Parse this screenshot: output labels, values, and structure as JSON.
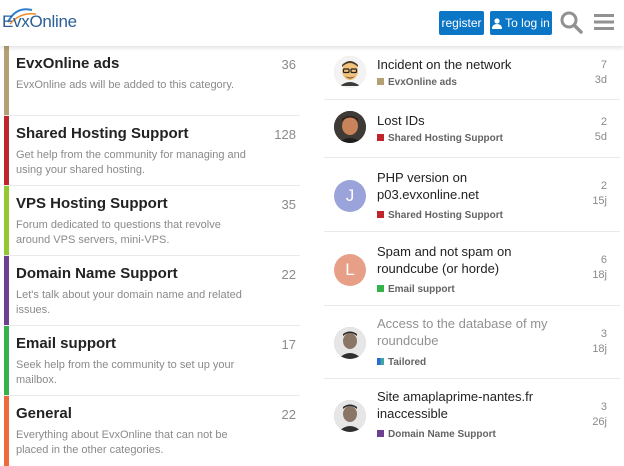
{
  "header": {
    "logo_text": "EvxOnline",
    "register_label": "register",
    "login_label": "To log in"
  },
  "colors": {
    "accent": "#0c76c6",
    "ads": "#b3a173",
    "shared": "#c0252e",
    "vps": "#92c830",
    "domain": "#6c3f91",
    "email": "#35b34a",
    "general": "#ee6a3a",
    "tailored_a": "#2a6ad6",
    "tailored_b": "#3fa6a3"
  },
  "categories": [
    {
      "name": "EvxOnline ads",
      "count": "36",
      "desc": "EvxOnline ads will be added to this category."
    },
    {
      "name": "Shared Hosting Support",
      "count": "128",
      "desc": "Get help from the community for managing and using your shared hosting."
    },
    {
      "name": "VPS Hosting Support",
      "count": "35",
      "desc": "Forum dedicated to questions that revolve around VPS servers, mini-VPS."
    },
    {
      "name": "Domain Name Support",
      "count": "22",
      "desc": "Let's talk about your domain name and related issues."
    },
    {
      "name": "Email support",
      "count": "17",
      "desc": "Seek help from the community to set up your mailbox."
    },
    {
      "name": "General",
      "count": "22",
      "desc": "Everything about EvxOnline that can not be placed in the other categories."
    }
  ],
  "topics": [
    {
      "title": "Incident on the network",
      "category": "EvxOnline ads",
      "replies": "7",
      "age": "3d",
      "avatar": "photo-avatar"
    },
    {
      "title": "Lost IDs",
      "category": "Shared Hosting Support",
      "replies": "2",
      "age": "5d",
      "avatar": "photo-avatar"
    },
    {
      "title": "PHP version on p03.evxonline.net",
      "category": "Shared Hosting Support",
      "replies": "2",
      "age": "15j",
      "avatar_letter": "J"
    },
    {
      "title": "Spam and not spam on roundcube (or horde)",
      "category": "Email support",
      "replies": "6",
      "age": "18j",
      "avatar_letter": "L"
    },
    {
      "title": "Access to the database of my roundcube",
      "category": "Tailored",
      "replies": "3",
      "age": "18j",
      "avatar": "photo-avatar"
    },
    {
      "title": "Site amaplaprime-nantes.fr inaccessible",
      "category": "Domain Name Support",
      "replies": "3",
      "age": "26j",
      "avatar": "photo-avatar"
    }
  ]
}
